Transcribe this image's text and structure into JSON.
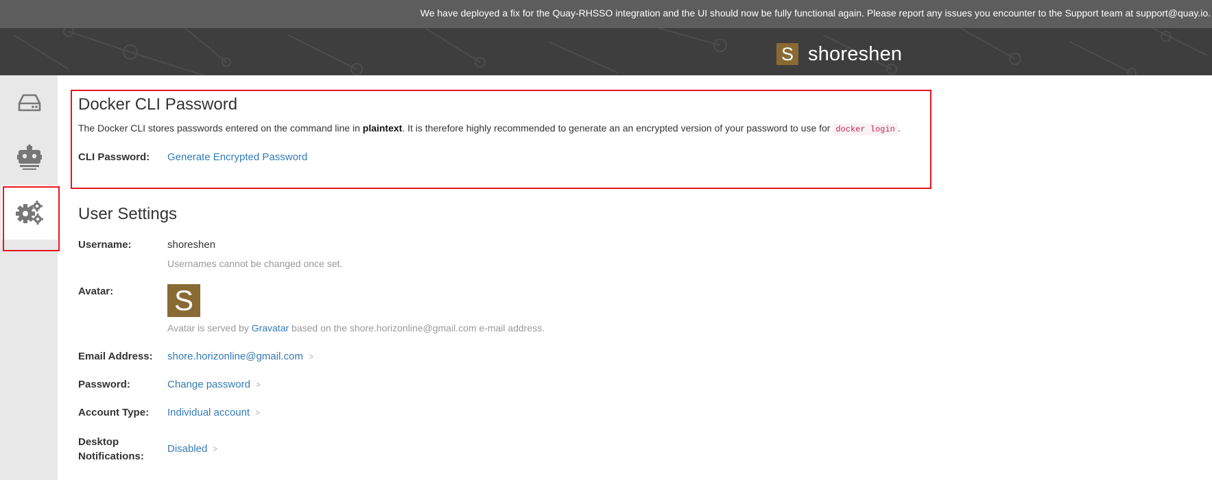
{
  "banner": {
    "text": "We have deployed a fix for the Quay-RHSSO integration and the UI should now be fully functional again. Please report any issues you encounter to the Support team at support@quay.io."
  },
  "header": {
    "avatar_letter": "S",
    "username": "shoreshen"
  },
  "sidebar": {
    "items": [
      {
        "icon": "hard-drive-icon"
      },
      {
        "icon": "robot-icon"
      },
      {
        "icon": "gears-icon",
        "active": true
      }
    ]
  },
  "docker_cli": {
    "title": "Docker CLI Password",
    "desc_before": "The Docker CLI stores passwords entered on the command line in ",
    "desc_bold": "plaintext",
    "desc_after": ". It is therefore highly recommended to generate an an encrypted version of your password to use for ",
    "desc_code": "docker login",
    "desc_end": ".",
    "cli_label": "CLI Password:",
    "generate_link": "Generate Encrypted Password"
  },
  "user_settings": {
    "title": "User Settings",
    "username_label": "Username:",
    "username_value": "shoreshen",
    "username_help": "Usernames cannot be changed once set.",
    "avatar_label": "Avatar:",
    "avatar_letter": "S",
    "avatar_help_before": "Avatar is served by ",
    "avatar_help_link": "Gravatar",
    "avatar_help_after": " based on the shore.horizonline@gmail.com e-mail address.",
    "email_label": "Email Address:",
    "email_value": "shore.horizonline@gmail.com",
    "password_label": "Password:",
    "password_value": "Change password",
    "account_type_label": "Account Type:",
    "account_type_value": "Individual account",
    "notifications_label_line1": "Desktop",
    "notifications_label_line2": "Notifications:",
    "notifications_value": "Disabled"
  },
  "colors": {
    "highlight": "#e8131b",
    "link": "#337ab7",
    "avatar": "#8a6a34"
  }
}
